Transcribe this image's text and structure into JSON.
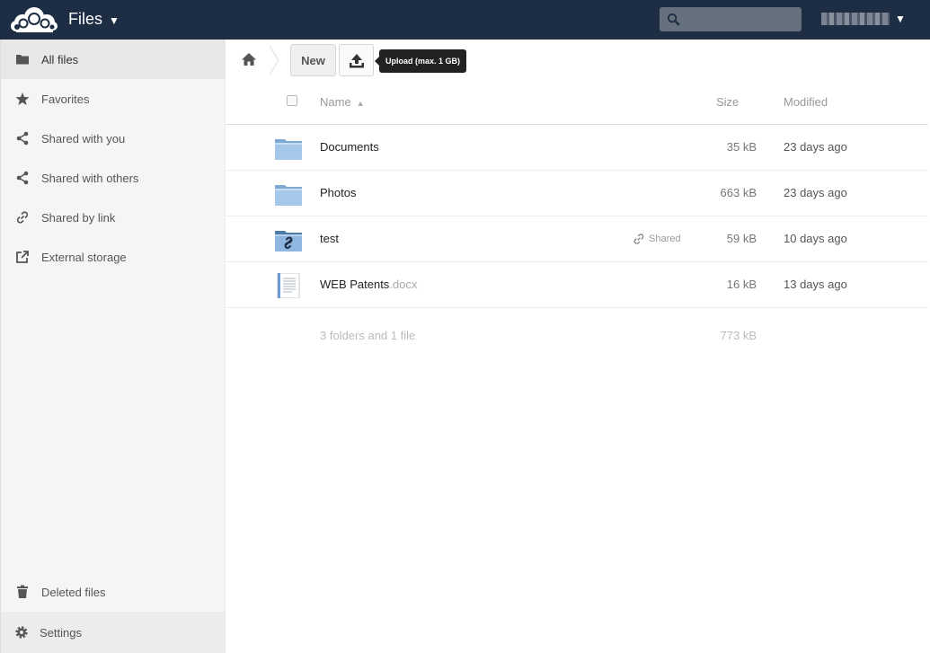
{
  "header": {
    "app_title": "Files",
    "search": {
      "placeholder": "",
      "value": ""
    },
    "user_name_hidden": true
  },
  "sidebar": {
    "items": [
      {
        "label": "All files",
        "icon": "folder-icon",
        "active": true
      },
      {
        "label": "Favorites",
        "icon": "star-icon"
      },
      {
        "label": "Shared with you",
        "icon": "share-icon"
      },
      {
        "label": "Shared with others",
        "icon": "share-icon"
      },
      {
        "label": "Shared by link",
        "icon": "link-icon"
      },
      {
        "label": "External storage",
        "icon": "external-icon"
      }
    ],
    "deleted_label": "Deleted files",
    "settings_label": "Settings"
  },
  "controls": {
    "new_label": "New",
    "upload_tooltip": "Upload (max. 1 GB)"
  },
  "table": {
    "headers": {
      "name": "Name",
      "size": "Size",
      "modified": "Modified"
    },
    "rows": [
      {
        "name": "Documents",
        "ext": "",
        "type": "folder",
        "size": "35 kB",
        "modified": "23 days ago",
        "shared": ""
      },
      {
        "name": "Photos",
        "ext": "",
        "type": "folder",
        "size": "663 kB",
        "modified": "23 days ago",
        "shared": ""
      },
      {
        "name": "test",
        "ext": "",
        "type": "folder-link",
        "size": "59 kB",
        "modified": "10 days ago",
        "shared": "Shared"
      },
      {
        "name": "WEB Patents",
        "ext": ".docx",
        "type": "document",
        "size": "16 kB",
        "modified": "13 days ago",
        "shared": ""
      }
    ],
    "summary": {
      "label": "3 folders and 1 file",
      "size": "773 kB"
    }
  },
  "colors": {
    "header_bg": "#1d2d44",
    "folder_blue": "#9dc3e8",
    "sidebar_bg": "#f5f5f5"
  }
}
